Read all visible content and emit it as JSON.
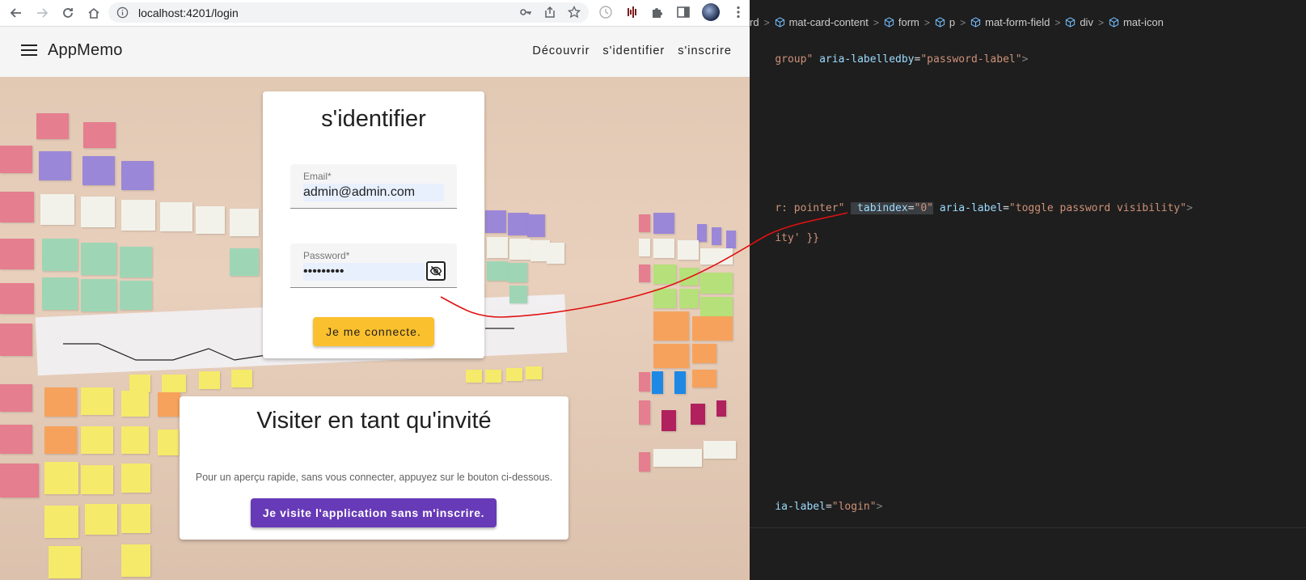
{
  "browser": {
    "url": "localhost:4201/login"
  },
  "app": {
    "brand": "AppMemo",
    "nav": [
      "Découvrir",
      "s'identifier",
      "s'inscrire"
    ]
  },
  "login": {
    "title": "s'identifier",
    "email_label": "Email*",
    "email_value": "admin@admin.com",
    "password_label": "Password*",
    "password_value": "•••••••••",
    "submit_label": "Je me connecte."
  },
  "guest": {
    "title": "Visiter en tant qu'invité",
    "text": "Pour un aperçu rapide, sans vous connecter, appuyez sur le bouton ci-dessous.",
    "button_label": "Je visite l'application sans m'inscrire."
  },
  "devtools": {
    "breadcrumbs": [
      "rd",
      "mat-card-content",
      "form",
      "p",
      "mat-form-field",
      "div",
      "mat-icon"
    ],
    "lines": {
      "l1": {
        "a": "group\"",
        "b": " aria-labelledby",
        "c": "=",
        "d": "\"password-label\"",
        "e": ">"
      },
      "l2": {
        "a": "r: pointer\"",
        "b": " tabindex",
        "c": "=",
        "d": "\"0\"",
        "e": " aria-label",
        "f": "=",
        "g": "\"toggle password visibility\"",
        "h": ">"
      },
      "l3": {
        "a": "ity' }}"
      },
      "l4": {
        "a": "ia-label",
        "b": "=",
        "c": "\"login\"",
        "d": ">"
      }
    }
  },
  "colors": {
    "accent_yellow": "#fbc02d",
    "accent_purple": "#673ab7",
    "annotation_red": "#e01010"
  }
}
